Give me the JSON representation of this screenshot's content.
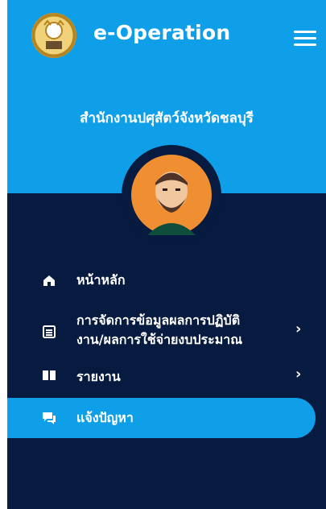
{
  "app": {
    "title": "e-Operation",
    "office": "สำนักงานปศุสัตว์จังหวัดชลบุรี",
    "accent": "#0f9fe8",
    "nav_bg": "#071a3f"
  },
  "nav": {
    "items": [
      {
        "label": "หน้าหลัก",
        "icon": "home-icon",
        "has_submenu": false
      },
      {
        "label_line1": "การจัดการข้อมูลผลการปฏิบัติ",
        "label_line2": "งาน/ผลการใช้จ่ายงบประมาณ",
        "icon": "calendar-icon",
        "has_submenu": true
      },
      {
        "label": "รายงาน",
        "icon": "book-icon",
        "has_submenu": true
      },
      {
        "label": "แจ้งปัญหา",
        "icon": "chat-icon",
        "has_submenu": false,
        "active": true
      }
    ],
    "chevron": "›"
  }
}
